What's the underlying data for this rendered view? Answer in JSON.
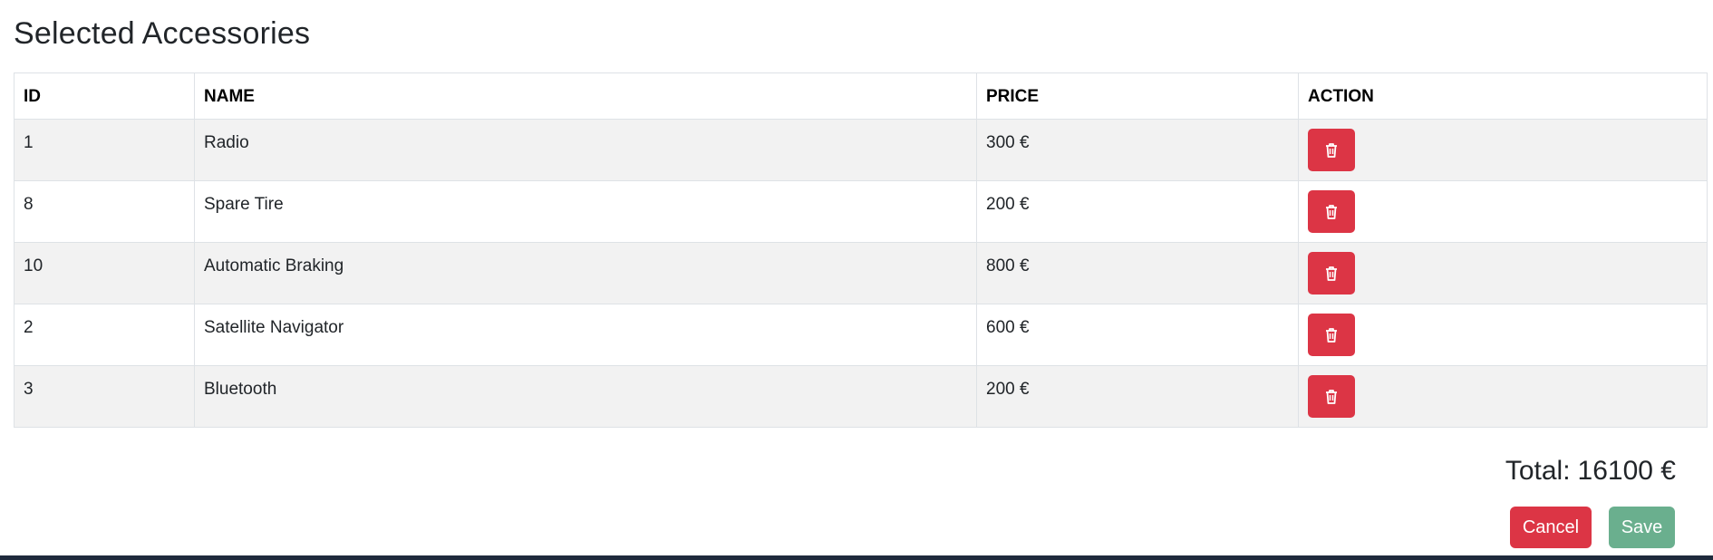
{
  "page": {
    "title": "Selected Accessories"
  },
  "table": {
    "headers": {
      "id": "ID",
      "name": "NAME",
      "price": "PRICE",
      "action": "ACTION"
    },
    "rows": [
      {
        "id": "1",
        "name": "Radio",
        "price": "300 €",
        "action_icon": "trash-icon"
      },
      {
        "id": "8",
        "name": "Spare Tire",
        "price": "200 €",
        "action_icon": "trash-icon"
      },
      {
        "id": "10",
        "name": "Automatic Braking",
        "price": "800 €",
        "action_icon": "trash-icon"
      },
      {
        "id": "2",
        "name": "Satellite Navigator",
        "price": "600 €",
        "action_icon": "trash-icon"
      },
      {
        "id": "3",
        "name": "Bluetooth",
        "price": "200 €",
        "action_icon": "trash-icon"
      }
    ]
  },
  "summary": {
    "total_label": "Total:",
    "total_value": "16100 €"
  },
  "buttons": {
    "cancel_label": "Cancel",
    "save_label": "Save"
  },
  "colors": {
    "danger": "#dc3545",
    "success_muted": "#6aaf8e",
    "stripe": "#f2f2f2",
    "footer_bar": "#1f2a3c"
  }
}
